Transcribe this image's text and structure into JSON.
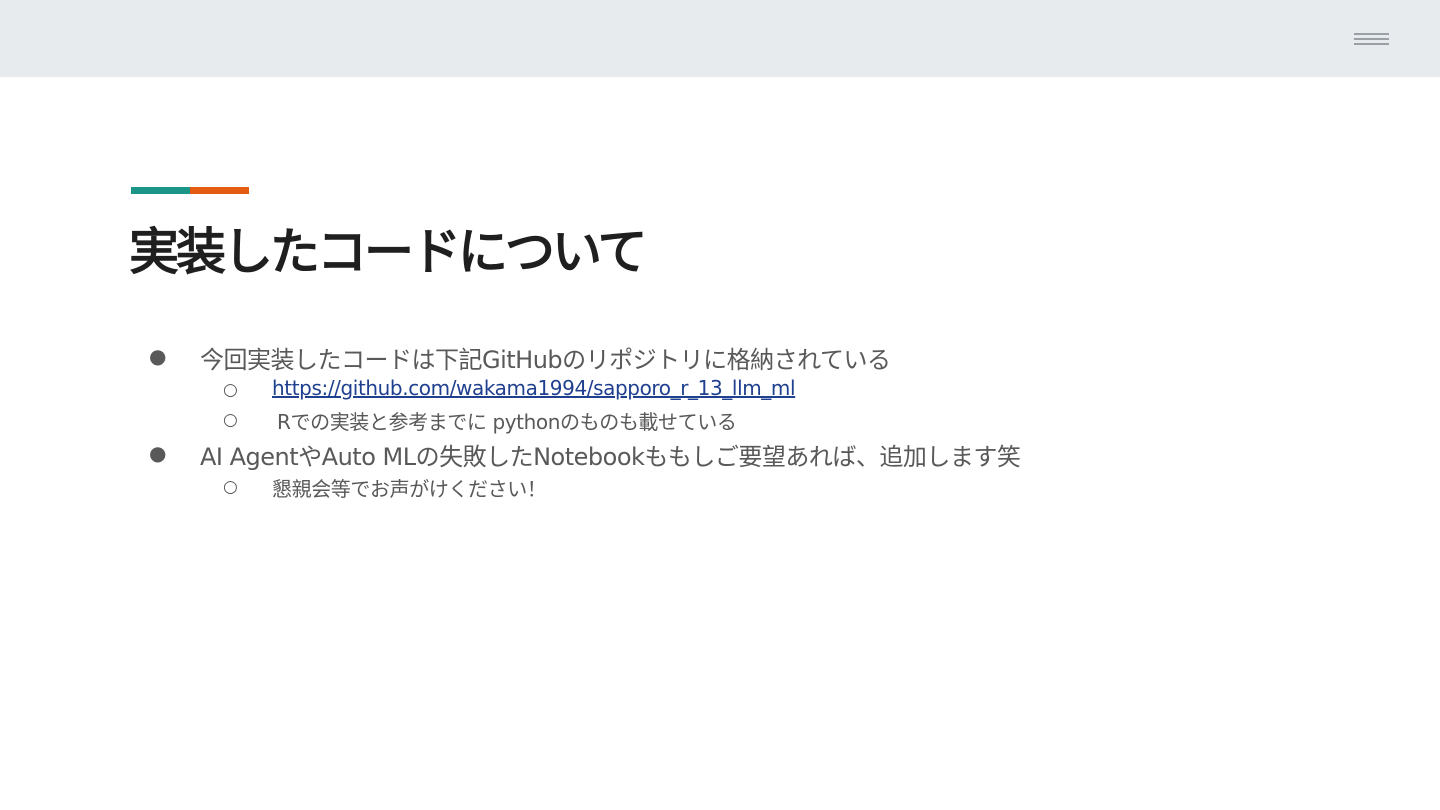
{
  "colors": {
    "accent_teal": "#1b9588",
    "accent_orange": "#e45c11"
  },
  "header": {
    "menu_icon": "hamburger-menu-icon"
  },
  "slide": {
    "title": "実装したコードについて",
    "bullets": [
      {
        "marker": "●",
        "text": "今回実装したコードは下記GitHubのリポジトリに格納されている",
        "children": [
          {
            "marker": "○",
            "text": "https://github.com/wakama1994/sapporo_r_13_llm_ml"
          },
          {
            "marker": "○",
            "text": "Rでの実装と参考までに pythonのものも載せている"
          }
        ]
      },
      {
        "marker": "●",
        "text": "AI AgentやAuto MLの失敗したNotebookももしご要望あれば、追加します笑",
        "children": [
          {
            "marker": "○",
            "text": "懇親会等でお声がけください！"
          }
        ]
      }
    ]
  }
}
